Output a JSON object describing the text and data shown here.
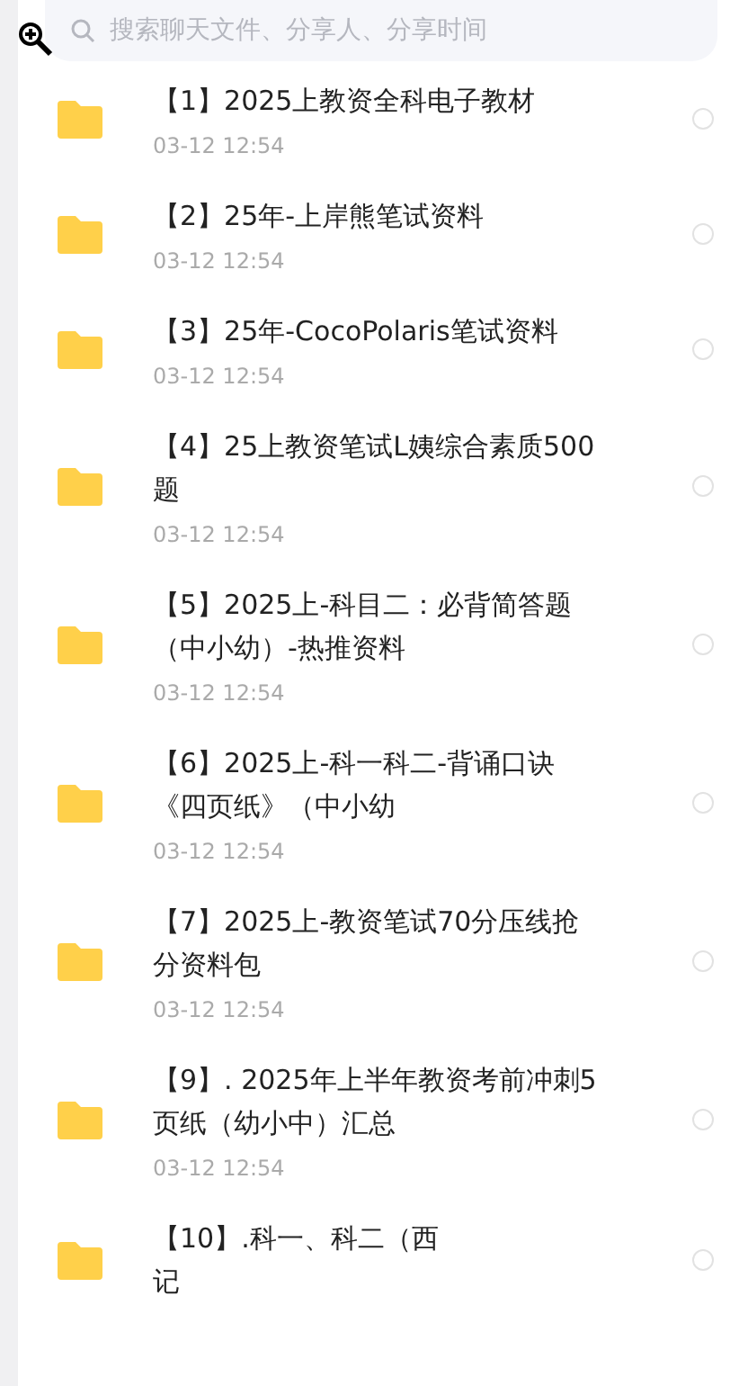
{
  "search": {
    "placeholder": "搜索聊天文件、分享人、分享时间"
  },
  "files": [
    {
      "lines": [
        "【1】2025上教资全科电子教材"
      ],
      "time": "03-12  12:54",
      "selected": false
    },
    {
      "lines": [
        "【2】25年-上岸熊笔试资料"
      ],
      "time": "03-12  12:54",
      "selected": false
    },
    {
      "lines": [
        "【3】25年-CocoPolaris笔试资料"
      ],
      "time": "03-12  12:54",
      "selected": false
    },
    {
      "lines": [
        "【4】25上教资笔试L姨综合素质500",
        "题"
      ],
      "time": "03-12  12:54",
      "selected": false
    },
    {
      "lines": [
        "【5】2025上-科目二：必背简答题",
        "（中小幼）-热推资料"
      ],
      "time": "03-12  12:54",
      "selected": false
    },
    {
      "lines": [
        "【6】2025上-科一科二-背诵口诀",
        "《四页纸》（中小幼"
      ],
      "time": "03-12  12:54",
      "selected": false
    },
    {
      "lines": [
        "【7】2025上-教资笔试70分压线抢",
        "分资料包"
      ],
      "time": "03-12  12:54",
      "selected": false
    },
    {
      "lines": [
        "【9】. 2025年上半年教资考前冲刺5",
        "页纸（幼小中）汇总"
      ],
      "time": "03-12  12:54",
      "selected": false
    },
    {
      "lines": [
        "【10】.科一、科二（西",
        "记"
      ],
      "selected": false
    }
  ]
}
